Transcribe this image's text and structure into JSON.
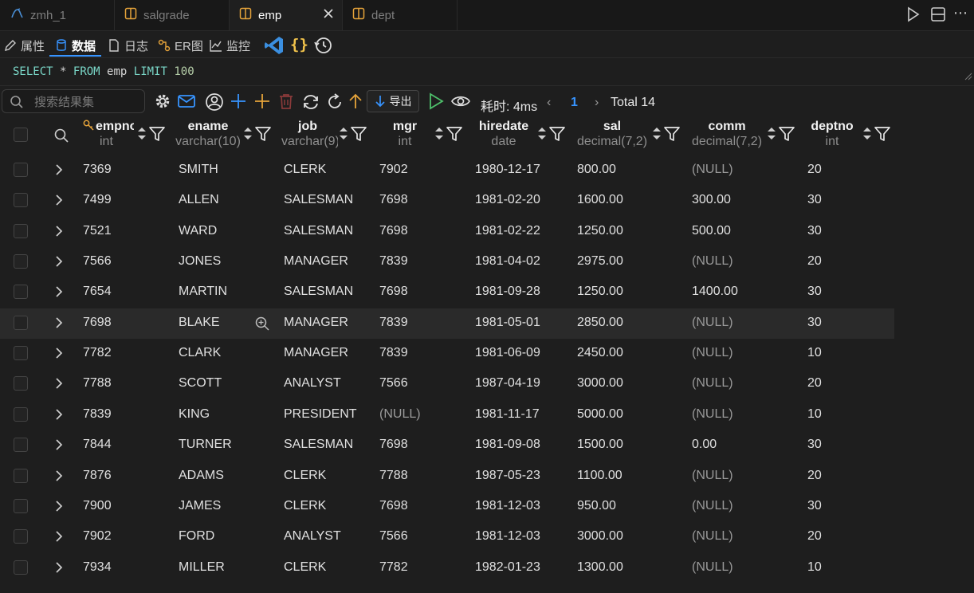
{
  "tabs": [
    {
      "label": "zmh_1",
      "icon": "mysql-icon",
      "active": false
    },
    {
      "label": "salgrade",
      "icon": "table-icon",
      "active": false
    },
    {
      "label": "emp",
      "icon": "table-icon",
      "active": true
    },
    {
      "label": "dept",
      "icon": "table-icon",
      "active": false
    }
  ],
  "toolbar": {
    "properties_label": "属性",
    "data_label": "数据",
    "log_label": "日志",
    "er_label": "ER图",
    "monitor_label": "监控"
  },
  "query": {
    "text": "SELECT * FROM emp LIMIT 100"
  },
  "results": {
    "search_placeholder": "搜索结果集",
    "export_label": "导出",
    "timing": "耗时: 4ms",
    "page": "1",
    "total": "Total 14"
  },
  "columns": [
    {
      "name": "empno",
      "type": "int",
      "key": true
    },
    {
      "name": "ename",
      "type": "varchar(10)"
    },
    {
      "name": "job",
      "type": "varchar(9)"
    },
    {
      "name": "mgr",
      "type": "int"
    },
    {
      "name": "hiredate",
      "type": "date"
    },
    {
      "name": "sal",
      "type": "decimal(7,2)"
    },
    {
      "name": "comm",
      "type": "decimal(7,2)"
    },
    {
      "name": "deptno",
      "type": "int"
    }
  ],
  "rows": [
    [
      "7369",
      "SMITH",
      "CLERK",
      "7902",
      "1980-12-17",
      "800.00",
      "(NULL)",
      "20"
    ],
    [
      "7499",
      "ALLEN",
      "SALESMAN",
      "7698",
      "1981-02-20",
      "1600.00",
      "300.00",
      "30"
    ],
    [
      "7521",
      "WARD",
      "SALESMAN",
      "7698",
      "1981-02-22",
      "1250.00",
      "500.00",
      "30"
    ],
    [
      "7566",
      "JONES",
      "MANAGER",
      "7839",
      "1981-04-02",
      "2975.00",
      "(NULL)",
      "20"
    ],
    [
      "7654",
      "MARTIN",
      "SALESMAN",
      "7698",
      "1981-09-28",
      "1250.00",
      "1400.00",
      "30"
    ],
    [
      "7698",
      "BLAKE",
      "MANAGER",
      "7839",
      "1981-05-01",
      "2850.00",
      "(NULL)",
      "30"
    ],
    [
      "7782",
      "CLARK",
      "MANAGER",
      "7839",
      "1981-06-09",
      "2450.00",
      "(NULL)",
      "10"
    ],
    [
      "7788",
      "SCOTT",
      "ANALYST",
      "7566",
      "1987-04-19",
      "3000.00",
      "(NULL)",
      "20"
    ],
    [
      "7839",
      "KING",
      "PRESIDENT",
      "(NULL)",
      "1981-11-17",
      "5000.00",
      "(NULL)",
      "10"
    ],
    [
      "7844",
      "TURNER",
      "SALESMAN",
      "7698",
      "1981-09-08",
      "1500.00",
      "0.00",
      "30"
    ],
    [
      "7876",
      "ADAMS",
      "CLERK",
      "7788",
      "1987-05-23",
      "1100.00",
      "(NULL)",
      "20"
    ],
    [
      "7900",
      "JAMES",
      "CLERK",
      "7698",
      "1981-12-03",
      "950.00",
      "(NULL)",
      "30"
    ],
    [
      "7902",
      "FORD",
      "ANALYST",
      "7566",
      "1981-12-03",
      "3000.00",
      "(NULL)",
      "20"
    ],
    [
      "7934",
      "MILLER",
      "CLERK",
      "7782",
      "1982-01-23",
      "1300.00",
      "(NULL)",
      "10"
    ]
  ],
  "highlighted_row": 5,
  "colors": {
    "accent": "#3794ff",
    "add": "#e5a33a",
    "run": "#4ec06b",
    "delete": "#b03a3a"
  }
}
